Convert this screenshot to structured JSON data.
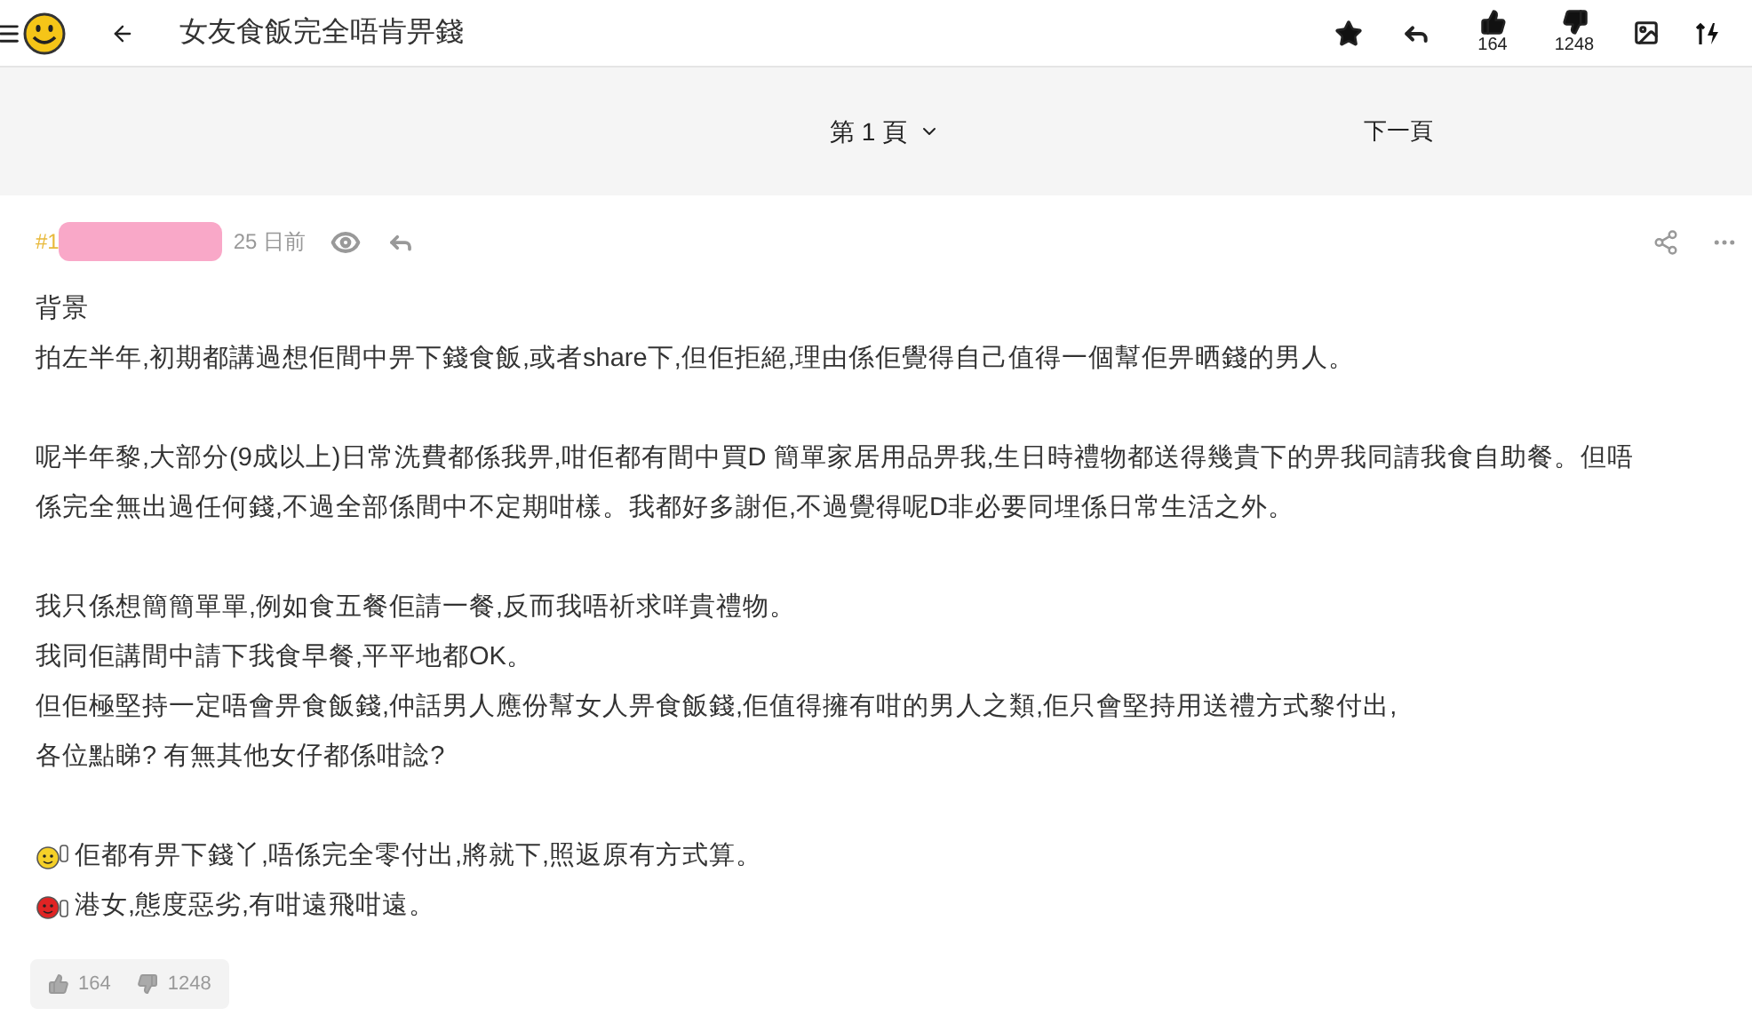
{
  "topbar": {
    "title": "女友食飯完全唔肯畀錢",
    "likes": "164",
    "dislikes": "1248"
  },
  "pager": {
    "current": "第 1 頁",
    "next": "下一頁"
  },
  "post": {
    "number": "#1",
    "time": "25 日前",
    "paragraphs": [
      [
        "背景",
        "拍左半年,初期都講過想佢間中畀下錢食飯,或者share下,但佢拒絕,理由係佢覺得自己值得一個幫佢畀晒錢的男人。"
      ],
      [
        "呢半年黎,大部分(9成以上)日常洗費都係我畀,咁佢都有間中買D 簡單家居用品畀我,生日時禮物都送得幾貴下的畀我同請我食自助餐。但唔",
        "係完全無出過任何錢,不過全部係間中不定期咁樣。我都好多謝佢,不過覺得呢D非必要同埋係日常生活之外。"
      ],
      [
        "我只係想簡簡單單,例如食五餐佢請一餐,反而我唔祈求咩貴禮物。",
        "我同佢講間中請下我食早餐,平平地都OK。",
        "但佢極堅持一定唔會畀食飯錢,仲話男人應份幫女人畀食飯錢,佢值得擁有咁的男人之類,佢只會堅持用送禮方式黎付出,",
        "各位點睇? 有無其他女仔都係咁諗?"
      ]
    ],
    "polls": [
      {
        "kind": "agree",
        "text": "佢都有畀下錢丫,唔係完全零付出,將就下,照返原有方式算。"
      },
      {
        "kind": "disagree",
        "text": "港女,態度惡劣,有咁遠飛咁遠。"
      }
    ],
    "votes": {
      "likes": "164",
      "dislikes": "1248"
    }
  }
}
